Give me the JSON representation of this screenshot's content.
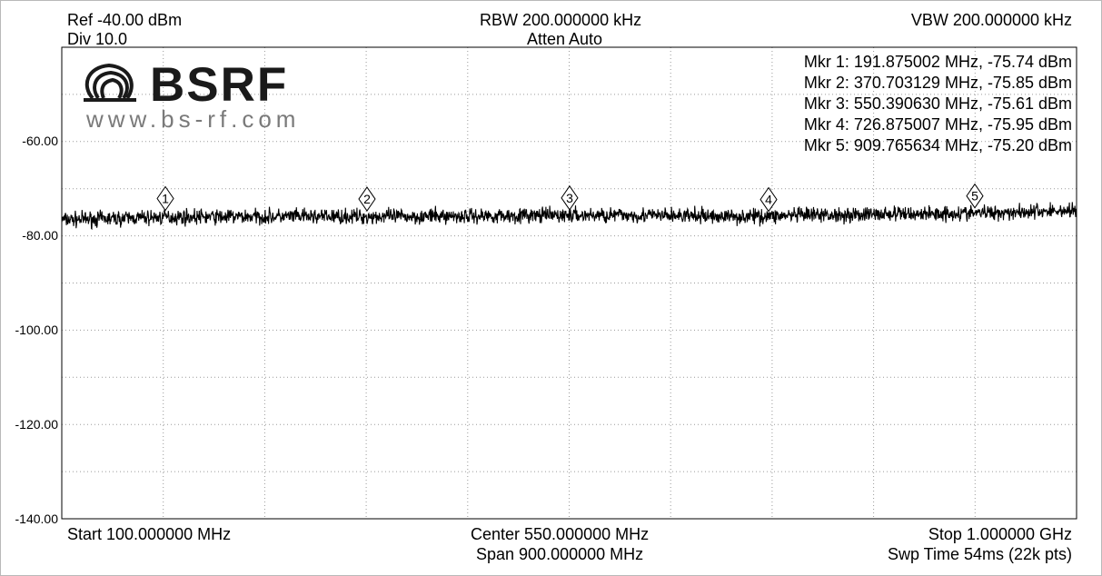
{
  "header": {
    "ref": "Ref -40.00 dBm",
    "div": "Div 10.0",
    "rbw": "RBW 200.000000 kHz",
    "atten": "Atten Auto",
    "vbw": "VBW 200.000000 kHz"
  },
  "footer": {
    "start": "Start 100.000000 MHz",
    "center": "Center 550.000000 MHz",
    "span": "Span 900.000000 MHz",
    "stop": "Stop 1.000000 GHz",
    "swp": "Swp Time 54ms (22k pts)"
  },
  "logo": {
    "brand": "BSRF",
    "url": "www.bs-rf.com"
  },
  "marker_readouts": [
    "Mkr 1: 191.875002 MHz, -75.74 dBm",
    "Mkr 2: 370.703129 MHz, -75.85 dBm",
    "Mkr 3: 550.390630 MHz, -75.61 dBm",
    "Mkr 4: 726.875007 MHz, -75.95 dBm",
    "Mkr 5: 909.765634 MHz, -75.20 dBm"
  ],
  "colors": {
    "trace": "#000000",
    "grid": "#9a9a9a",
    "background": "#ffffff"
  },
  "chart_data": {
    "type": "line",
    "x_unit": "MHz",
    "y_unit": "dBm",
    "xlim": [
      100,
      1000
    ],
    "ylim": [
      -140,
      -40
    ],
    "y_ticks": [
      {
        "value": -60,
        "label": "-60.00"
      },
      {
        "value": -80,
        "label": "-80.00"
      },
      {
        "value": -100,
        "label": "-100.00"
      },
      {
        "value": -120,
        "label": "-120.00"
      },
      {
        "value": -140,
        "label": "-140.00"
      }
    ],
    "grid": true,
    "grid_divisions_x": 10,
    "grid_divisions_y": 10,
    "series": [
      {
        "x": [
          100,
          200,
          300,
          400,
          500,
          600,
          700,
          800,
          900,
          1000
        ],
        "values": [
          -76.6,
          -76.0,
          -75.9,
          -75.9,
          -75.7,
          -75.6,
          -75.9,
          -75.5,
          -75.2,
          -74.6
        ]
      }
    ],
    "markers": [
      {
        "label": "1",
        "x": 191.875002,
        "y": -75.74
      },
      {
        "label": "2",
        "x": 370.703129,
        "y": -75.85
      },
      {
        "label": "3",
        "x": 550.39063,
        "y": -75.61
      },
      {
        "label": "4",
        "x": 726.875007,
        "y": -75.95
      },
      {
        "label": "5",
        "x": 909.765634,
        "y": -75.2
      }
    ]
  }
}
